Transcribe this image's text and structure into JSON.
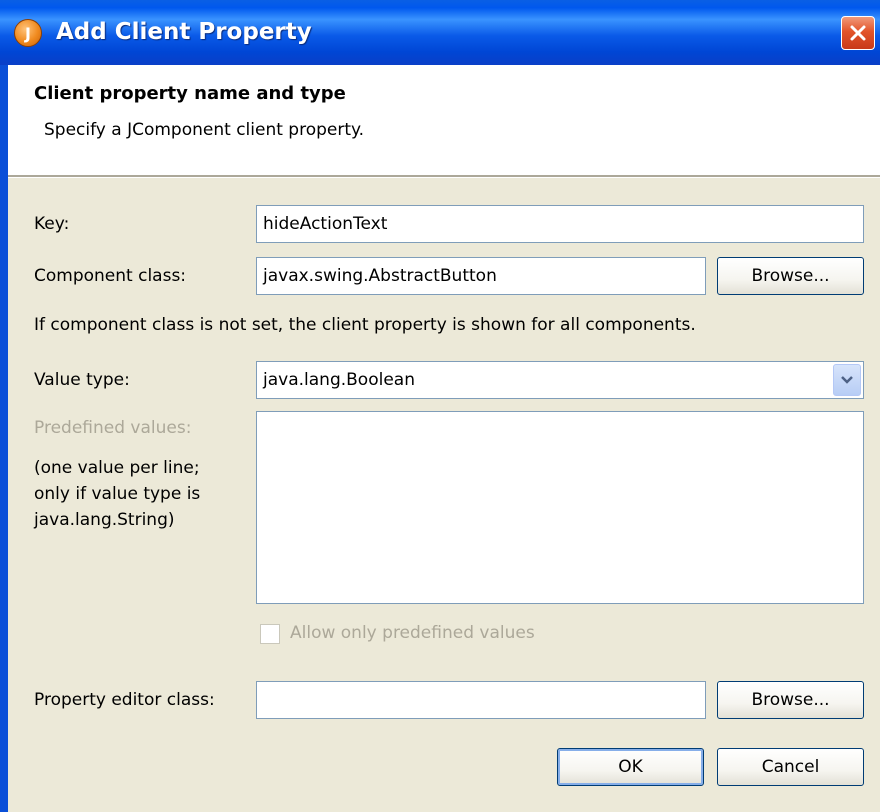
{
  "window": {
    "title": "Add Client Property",
    "app_icon_glyph": "J"
  },
  "header": {
    "title": "Client property name and type",
    "description": "Specify a JComponent client property."
  },
  "form": {
    "key_label": "Key:",
    "key_value": "hideActionText",
    "component_class_label": "Component class:",
    "component_class_value": "javax.swing.AbstractButton",
    "browse_label": "Browse...",
    "component_note": "If component class is not set, the client property is shown for all components.",
    "value_type_label": "Value type:",
    "value_type_selected": "java.lang.Boolean",
    "predefined_label": "Predefined values:",
    "predefined_help": [
      "(one value per line;",
      "only if value type is",
      "java.lang.String)"
    ],
    "allow_only_label": "Allow only predefined values",
    "editor_class_label": "Property editor class:",
    "editor_class_value": "",
    "editor_browse_label": "Browse..."
  },
  "buttons": {
    "ok": "OK",
    "cancel": "Cancel"
  },
  "colors": {
    "titlebar": "#0058ee",
    "dialog_bg": "#ece9d8",
    "field_border": "#7f9db9",
    "disabled_text": "#aca899",
    "close_button": "#e2542a"
  }
}
